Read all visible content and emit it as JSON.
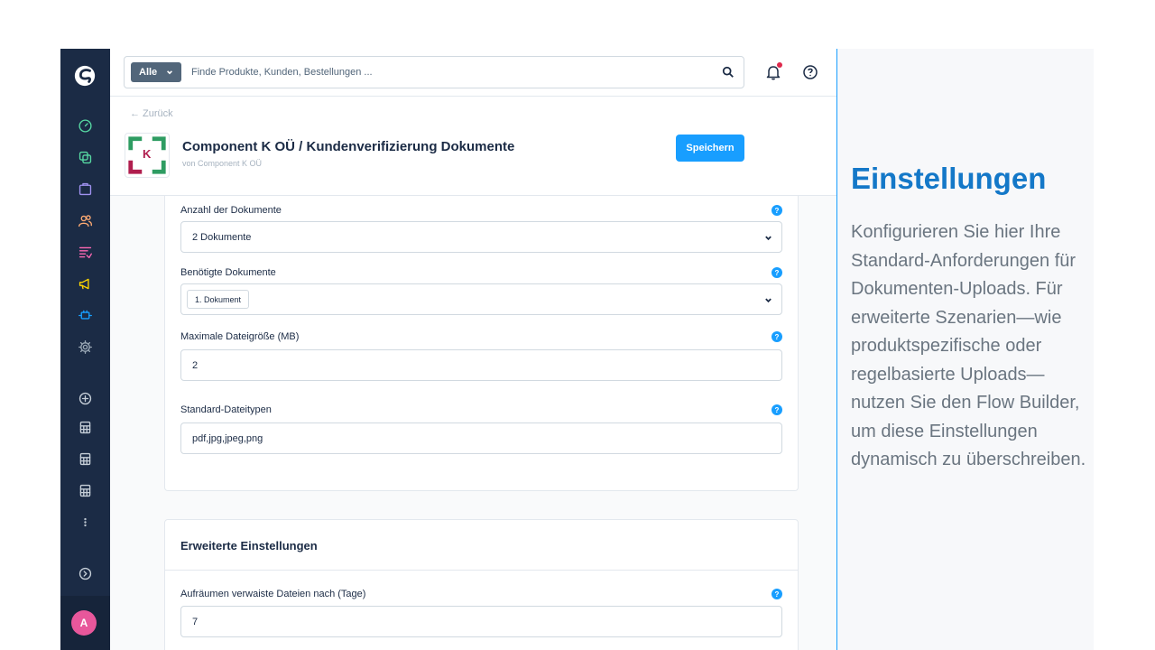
{
  "search": {
    "scope_label": "Alle",
    "placeholder": "Finde Produkte, Kunden, Bestellungen ..."
  },
  "header": {
    "back_label": "← Zurück",
    "logo_letter": "K",
    "title": "Component K OÜ / Kundenverifizierung Dokumente",
    "subtitle": "von Component K OÜ",
    "save_label": "Speichern"
  },
  "form": {
    "fields": [
      {
        "label": "Anzahl der Dokumente",
        "value": "2 Dokumente",
        "help": "?"
      },
      {
        "label": "Benötigte Dokumente",
        "chip": "1. Dokument",
        "help": "?"
      },
      {
        "label": "Maximale Dateigröße (MB)",
        "value": "2",
        "help": "?"
      },
      {
        "label": "Standard-Dateitypen",
        "value": "pdf,jpg,jpeg,png",
        "help": "?"
      }
    ]
  },
  "advanced": {
    "title": "Erweiterte Einstellungen",
    "fields": [
      {
        "label": "Aufräumen verwaiste Dateien nach (Tage)",
        "value": "7",
        "help": "?"
      }
    ]
  },
  "user": {
    "avatar_initial": "A"
  },
  "panel": {
    "title": "Einstellungen",
    "text": "Konfigurieren Sie hier Ihre Standard-Anforderungen für Dokumenten-Uploads. Für erweiterte Szenarien—wie produktspezifische oder regelbasierte Uploads—nutzen Sie den Flow Builder, um diese Einstellungen dynamisch zu überschreiben."
  },
  "colors": {
    "sidebar": "#1b2b45",
    "accent": "#189eff",
    "panel_title": "#1478c8",
    "avatar": "#e8579b"
  }
}
